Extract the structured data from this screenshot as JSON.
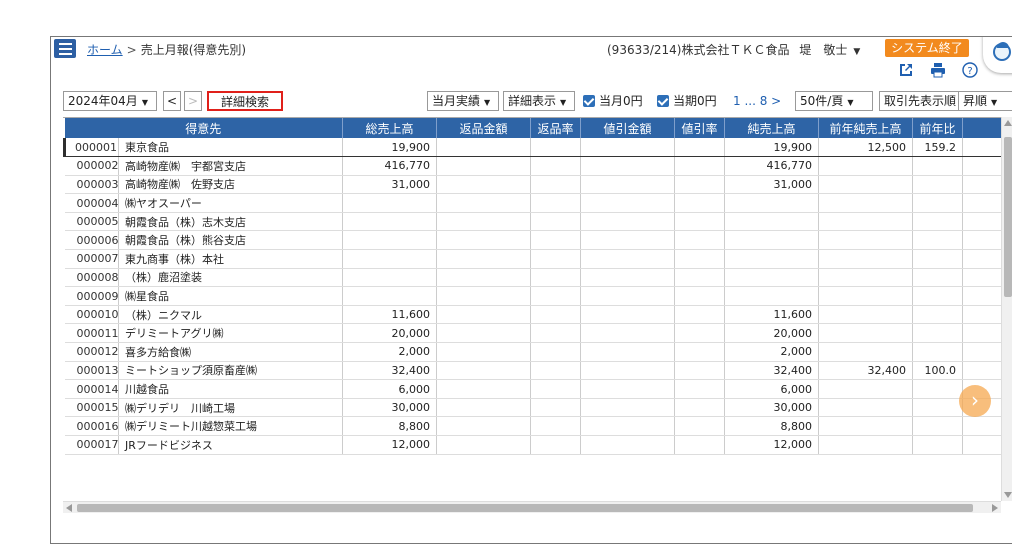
{
  "header": {
    "breadcrumb_home": "ホーム",
    "breadcrumb_sep": ">",
    "breadcrumb_current": "売上月報(得意先別)",
    "company": "(93633/214)株式会社ＴＫＣ食品",
    "user": "堤　敬士",
    "exit_label": "システム終了"
  },
  "toolbar": {
    "month": "2024年04月",
    "prev": "<",
    "next": ">",
    "detail_search": "詳細検索",
    "actuals": "当月実績",
    "detail_view": "詳細表示",
    "month_zero": "当月0円",
    "period_zero": "当期0円",
    "pager": "1 ... 8 >",
    "per_page": "50件/頁",
    "sort_order": "取引先表示順",
    "sort_dir": "昇順"
  },
  "table": {
    "columns": [
      "得意先",
      "総売上高",
      "返品金額",
      "返品率",
      "値引金額",
      "値引率",
      "純売上高",
      "前年純売上高",
      "前年比"
    ],
    "rows": [
      {
        "code": "000001",
        "name": "東京食品",
        "gross": "19,900",
        "ret": "",
        "ret_rate": "",
        "disc": "",
        "disc_rate": "",
        "net": "19,900",
        "prev_net": "12,500",
        "yoy": "159.2"
      },
      {
        "code": "000002",
        "name": "高崎物産㈱　宇都宮支店",
        "gross": "416,770",
        "ret": "",
        "ret_rate": "",
        "disc": "",
        "disc_rate": "",
        "net": "416,770",
        "prev_net": "",
        "yoy": ""
      },
      {
        "code": "000003",
        "name": "高崎物産㈱　佐野支店",
        "gross": "31,000",
        "ret": "",
        "ret_rate": "",
        "disc": "",
        "disc_rate": "",
        "net": "31,000",
        "prev_net": "",
        "yoy": ""
      },
      {
        "code": "000004",
        "name": "㈱ヤオスーパー",
        "gross": "",
        "ret": "",
        "ret_rate": "",
        "disc": "",
        "disc_rate": "",
        "net": "",
        "prev_net": "",
        "yoy": ""
      },
      {
        "code": "000005",
        "name": "朝霞食品（株）志木支店",
        "gross": "",
        "ret": "",
        "ret_rate": "",
        "disc": "",
        "disc_rate": "",
        "net": "",
        "prev_net": "",
        "yoy": ""
      },
      {
        "code": "000006",
        "name": "朝霞食品（株）熊谷支店",
        "gross": "",
        "ret": "",
        "ret_rate": "",
        "disc": "",
        "disc_rate": "",
        "net": "",
        "prev_net": "",
        "yoy": ""
      },
      {
        "code": "000007",
        "name": "東九商事（株）本社",
        "gross": "",
        "ret": "",
        "ret_rate": "",
        "disc": "",
        "disc_rate": "",
        "net": "",
        "prev_net": "",
        "yoy": ""
      },
      {
        "code": "000008",
        "name": "（株）鹿沼塗装",
        "gross": "",
        "ret": "",
        "ret_rate": "",
        "disc": "",
        "disc_rate": "",
        "net": "",
        "prev_net": "",
        "yoy": ""
      },
      {
        "code": "000009",
        "name": "㈱星食品",
        "gross": "",
        "ret": "",
        "ret_rate": "",
        "disc": "",
        "disc_rate": "",
        "net": "",
        "prev_net": "",
        "yoy": ""
      },
      {
        "code": "000010",
        "name": "（株）ニクマル",
        "gross": "11,600",
        "ret": "",
        "ret_rate": "",
        "disc": "",
        "disc_rate": "",
        "net": "11,600",
        "prev_net": "",
        "yoy": ""
      },
      {
        "code": "000011",
        "name": "デリミートアグリ㈱",
        "gross": "20,000",
        "ret": "",
        "ret_rate": "",
        "disc": "",
        "disc_rate": "",
        "net": "20,000",
        "prev_net": "",
        "yoy": ""
      },
      {
        "code": "000012",
        "name": "喜多方給食㈱",
        "gross": "2,000",
        "ret": "",
        "ret_rate": "",
        "disc": "",
        "disc_rate": "",
        "net": "2,000",
        "prev_net": "",
        "yoy": ""
      },
      {
        "code": "000013",
        "name": "ミートショップ須原畜産㈱",
        "gross": "32,400",
        "ret": "",
        "ret_rate": "",
        "disc": "",
        "disc_rate": "",
        "net": "32,400",
        "prev_net": "32,400",
        "yoy": "100.0"
      },
      {
        "code": "000014",
        "name": "川越食品",
        "gross": "6,000",
        "ret": "",
        "ret_rate": "",
        "disc": "",
        "disc_rate": "",
        "net": "6,000",
        "prev_net": "",
        "yoy": ""
      },
      {
        "code": "000015",
        "name": "㈱デリデリ　川崎工場",
        "gross": "30,000",
        "ret": "",
        "ret_rate": "",
        "disc": "",
        "disc_rate": "",
        "net": "30,000",
        "prev_net": "",
        "yoy": ""
      },
      {
        "code": "000016",
        "name": "㈱デリミート川越惣菜工場",
        "gross": "8,800",
        "ret": "",
        "ret_rate": "",
        "disc": "",
        "disc_rate": "",
        "net": "8,800",
        "prev_net": "",
        "yoy": ""
      },
      {
        "code": "000017",
        "name": "JRフードビジネス",
        "gross": "12,000",
        "ret": "",
        "ret_rate": "",
        "disc": "",
        "disc_rate": "",
        "net": "12,000",
        "prev_net": "",
        "yoy": ""
      }
    ]
  },
  "icons": [
    "menu-icon",
    "export-icon",
    "print-icon",
    "help-icon",
    "chevron-right-icon",
    "mascot-icon"
  ],
  "colors": {
    "header_blue": "#2e64a6",
    "exit_orange": "#f28a1e",
    "link_blue": "#1f5fb0",
    "highlight_red": "#e0201a"
  }
}
